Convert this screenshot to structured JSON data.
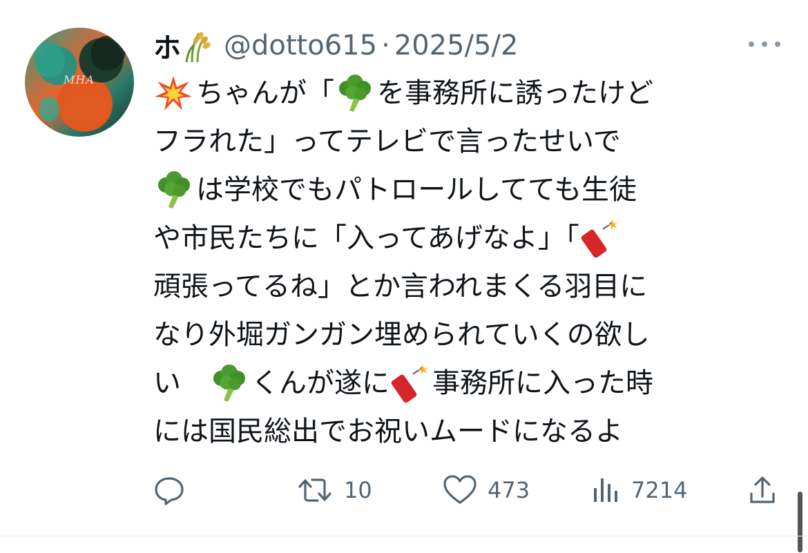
{
  "tweet": {
    "author": {
      "display_name": "ホ",
      "name_emoji": "rice-plant-emoji",
      "handle": "@dotto615",
      "separator": "·",
      "date": "2025/5/2",
      "avatar_text": "MHA"
    },
    "body_lines": [
      {
        "pre": "",
        "emoji": "collision-emoji",
        "post": "ちゃんが「",
        "emoji2": "broccoli-emoji",
        "post2": "を事務所に誘ったけど"
      },
      {
        "pre": "フラれた」ってテレビで言ったせいで",
        "emoji": "",
        "post": "",
        "emoji2": "",
        "post2": ""
      },
      {
        "pre": "",
        "emoji": "broccoli-emoji",
        "post": "は学校でもパトロールしてても生徒",
        "emoji2": "",
        "post2": ""
      },
      {
        "pre": "や市民たちに「入ってあげなよ」「",
        "emoji": "firecracker-emoji",
        "post": "",
        "emoji2": "",
        "post2": ""
      },
      {
        "pre": "頑張ってるね」とか言われまくる羽目に",
        "emoji": "",
        "post": "",
        "emoji2": "",
        "post2": ""
      },
      {
        "pre": "なり外堀ガンガン埋められていくの欲し",
        "emoji": "",
        "post": "",
        "emoji2": "",
        "post2": ""
      },
      {
        "pre": "い　",
        "emoji": "broccoli-emoji",
        "post": "くんが遂に",
        "emoji2": "firecracker-emoji",
        "post2": "事務所に入った時"
      },
      {
        "pre": "には国民総出でお祝いムードになるよ",
        "emoji": "",
        "post": "",
        "emoji2": "",
        "post2": ""
      }
    ],
    "actions": {
      "reply": {
        "icon": "reply-icon",
        "count": ""
      },
      "retweet": {
        "icon": "retweet-icon",
        "count": "10"
      },
      "like": {
        "icon": "heart-icon",
        "count": "473"
      },
      "views": {
        "icon": "views-icon",
        "count": "7214"
      },
      "share": {
        "icon": "share-icon",
        "count": ""
      }
    },
    "more_icon": "more-icon"
  },
  "colors": {
    "text": "#0f1419",
    "secondary": "#536471",
    "divider": "#e6e9ec",
    "broccoli": "#4a9a2e",
    "collision": "#f04a2a",
    "firecracker": "#d6262a"
  }
}
